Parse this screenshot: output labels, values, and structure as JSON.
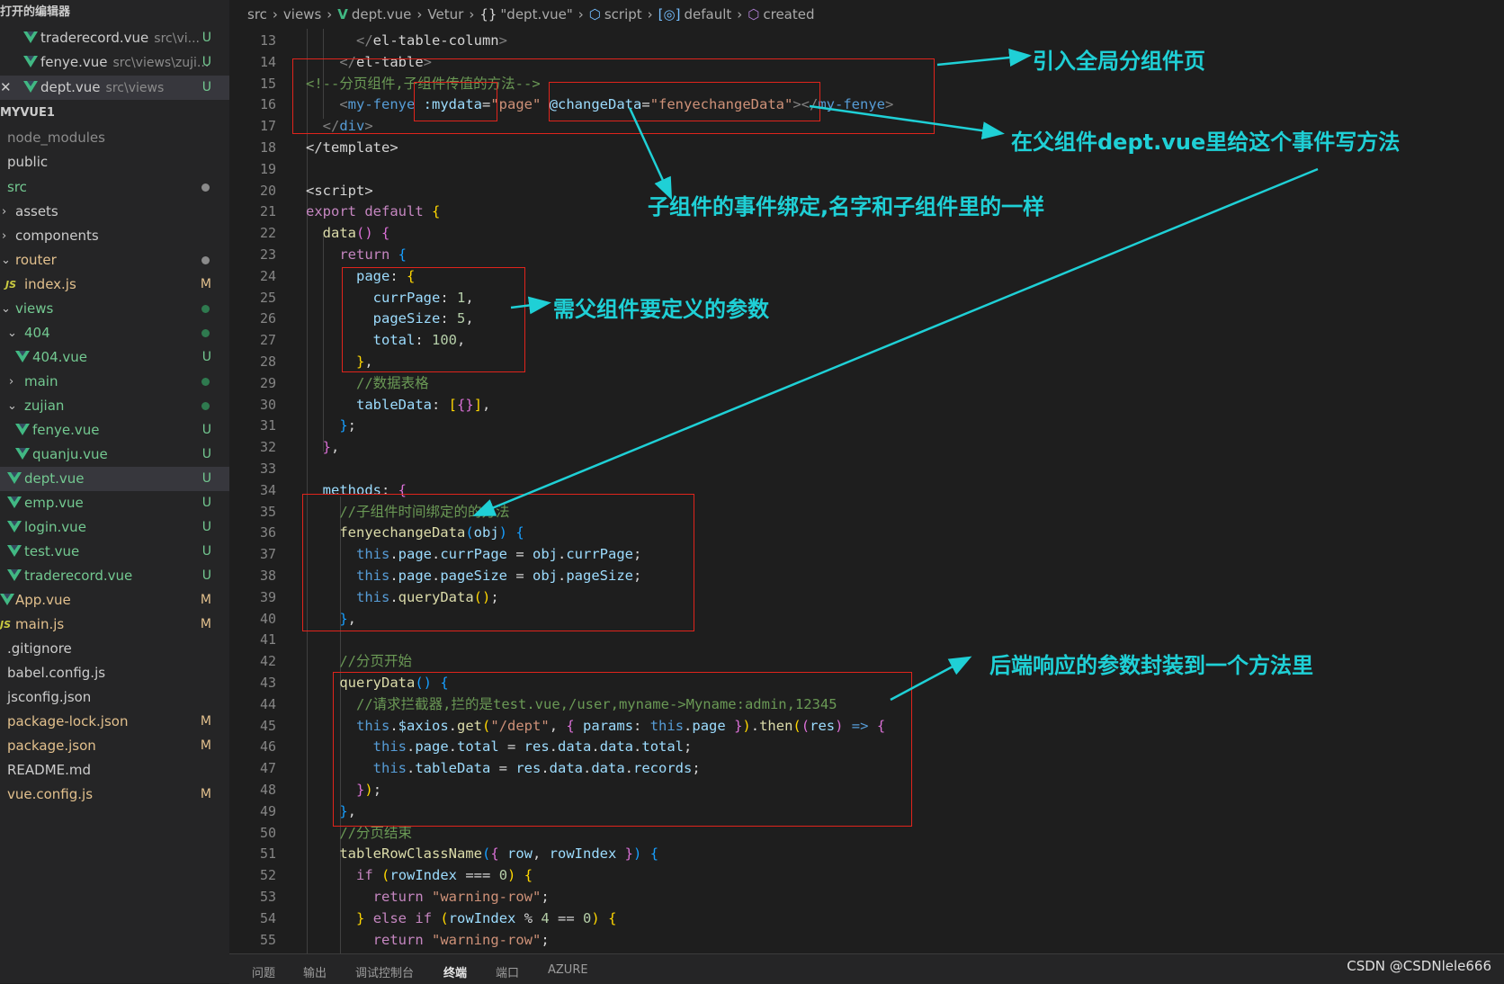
{
  "sidebar": {
    "open_editors_title": "打开的编辑器",
    "open_editors": [
      {
        "name": "traderecord.vue",
        "path": "src\\vi...",
        "badge": "U"
      },
      {
        "name": "fenye.vue",
        "path": "src\\views\\zuji...",
        "badge": "U"
      },
      {
        "name": "dept.vue",
        "path": "src\\views",
        "badge": "U"
      }
    ],
    "project_title": "MYVUE1",
    "tree": [
      {
        "name": "node_modules"
      },
      {
        "name": "public"
      },
      {
        "name": "src"
      },
      {
        "name": "assets"
      },
      {
        "name": "components"
      },
      {
        "name": "router"
      },
      {
        "name": "index.js",
        "badge": "M",
        "icon": "JS"
      },
      {
        "name": "views"
      },
      {
        "name": "404"
      },
      {
        "name": "404.vue",
        "badge": "U"
      },
      {
        "name": "main"
      },
      {
        "name": "zujian"
      },
      {
        "name": "fenye.vue",
        "badge": "U"
      },
      {
        "name": "quanju.vue",
        "badge": "U"
      },
      {
        "name": "dept.vue",
        "badge": "U"
      },
      {
        "name": "emp.vue",
        "badge": "U"
      },
      {
        "name": "login.vue",
        "badge": "U"
      },
      {
        "name": "test.vue",
        "badge": "U"
      },
      {
        "name": "traderecord.vue",
        "badge": "U"
      },
      {
        "name": "App.vue",
        "badge": "M"
      },
      {
        "name": "main.js",
        "badge": "M",
        "icon": "JS"
      },
      {
        "name": ".gitignore"
      },
      {
        "name": "babel.config.js"
      },
      {
        "name": "jsconfig.json"
      },
      {
        "name": "package-lock.json",
        "badge": "M"
      },
      {
        "name": "package.json",
        "badge": "M"
      },
      {
        "name": "README.md"
      },
      {
        "name": "vue.config.js",
        "badge": "M"
      }
    ]
  },
  "breadcrumb": [
    "src",
    "views",
    "dept.vue",
    "Vetur",
    "\"dept.vue\"",
    "script",
    "default",
    "created"
  ],
  "breadcrumb_icons": {
    "braces": "{}",
    "script": "⬡",
    "default": "[◎]",
    "created": "⬡"
  },
  "editor": {
    "line_numbers": [
      "13",
      "14",
      "15",
      "16",
      "17",
      "18",
      "19",
      "20",
      "21",
      "22",
      "23",
      "24",
      "25",
      "26",
      "27",
      "28",
      "29",
      "30",
      "31",
      "32",
      "33",
      "34",
      "35",
      "36",
      "37",
      "38",
      "39",
      "40",
      "41",
      "42",
      "43",
      "44",
      "45",
      "46",
      "47",
      "48",
      "49",
      "50",
      "51",
      "52",
      "53",
      "54",
      "55"
    ],
    "lines": [
      [
        [
          "t-tag",
          "      </"
        ],
        [
          "t-eltag",
          "el-table-column"
        ],
        [
          "t-tag",
          ">"
        ]
      ],
      [
        [
          "t-tag",
          "    </"
        ],
        [
          "t-eltag",
          "el-table"
        ],
        [
          "t-tag",
          ">"
        ]
      ],
      [
        [
          "t-com",
          "<!--分页组件,子组件传值的方法-->"
        ]
      ],
      [
        [
          "t-tag",
          "    <"
        ],
        [
          "t-tname",
          "my-fenye"
        ],
        [
          "t-plain",
          " "
        ],
        [
          "t-attr",
          ":mydata"
        ],
        [
          "t-plain",
          "="
        ],
        [
          "t-str",
          "\"page\""
        ],
        [
          "t-plain",
          " "
        ],
        [
          "t-attr",
          "@changeData"
        ],
        [
          "t-plain",
          "="
        ],
        [
          "t-str",
          "\"fenyechangeData\""
        ],
        [
          "t-tag",
          "></"
        ],
        [
          "t-tname",
          "my-fenye"
        ],
        [
          "t-tag",
          ">"
        ]
      ],
      [
        [
          "t-tag",
          "  </"
        ],
        [
          "t-tname",
          "div"
        ],
        [
          "t-tag",
          ">"
        ]
      ],
      [
        [
          "t-plain",
          "</template>"
        ]
      ],
      [
        [
          "t-plain",
          ""
        ]
      ],
      [
        [
          "t-plain",
          "<script>"
        ]
      ],
      [
        [
          "t-kw",
          "export"
        ],
        [
          "t-plain",
          " "
        ],
        [
          "t-kw",
          "default"
        ],
        [
          "t-plain",
          " "
        ],
        [
          "t-br1",
          "{"
        ]
      ],
      [
        [
          "t-plain",
          "  "
        ],
        [
          "t-fn",
          "data"
        ],
        [
          "t-br2",
          "()"
        ],
        [
          "t-plain",
          " "
        ],
        [
          "t-br2",
          "{"
        ]
      ],
      [
        [
          "t-plain",
          "    "
        ],
        [
          "t-kw",
          "return"
        ],
        [
          "t-plain",
          " "
        ],
        [
          "t-br3",
          "{"
        ]
      ],
      [
        [
          "t-plain",
          "      "
        ],
        [
          "t-var",
          "page"
        ],
        [
          "t-plain",
          ": "
        ],
        [
          "t-br1",
          "{"
        ]
      ],
      [
        [
          "t-plain",
          "        "
        ],
        [
          "t-var",
          "currPage"
        ],
        [
          "t-plain",
          ": "
        ],
        [
          "t-num",
          "1"
        ],
        [
          "t-plain",
          ","
        ]
      ],
      [
        [
          "t-plain",
          "        "
        ],
        [
          "t-var",
          "pageSize"
        ],
        [
          "t-plain",
          ": "
        ],
        [
          "t-num",
          "5"
        ],
        [
          "t-plain",
          ","
        ]
      ],
      [
        [
          "t-plain",
          "        "
        ],
        [
          "t-var",
          "total"
        ],
        [
          "t-plain",
          ": "
        ],
        [
          "t-num",
          "100"
        ],
        [
          "t-plain",
          ","
        ]
      ],
      [
        [
          "t-plain",
          "      "
        ],
        [
          "t-br1",
          "}"
        ],
        [
          "t-plain",
          ","
        ]
      ],
      [
        [
          "t-plain",
          "      "
        ],
        [
          "t-com",
          "//数据表格"
        ]
      ],
      [
        [
          "t-plain",
          "      "
        ],
        [
          "t-var",
          "tableData"
        ],
        [
          "t-plain",
          ": "
        ],
        [
          "t-br1",
          "["
        ],
        [
          "t-br2",
          "{}"
        ],
        [
          "t-br1",
          "]"
        ],
        [
          "t-plain",
          ","
        ]
      ],
      [
        [
          "t-plain",
          "    "
        ],
        [
          "t-br3",
          "}"
        ],
        [
          "t-plain",
          ";"
        ]
      ],
      [
        [
          "t-plain",
          "  "
        ],
        [
          "t-br2",
          "}"
        ],
        [
          "t-plain",
          ","
        ]
      ],
      [
        [
          "t-plain",
          ""
        ]
      ],
      [
        [
          "t-plain",
          "  "
        ],
        [
          "t-var",
          "methods"
        ],
        [
          "t-plain",
          ": "
        ],
        [
          "t-br2",
          "{"
        ]
      ],
      [
        [
          "t-plain",
          "    "
        ],
        [
          "t-com",
          "//子组件时间绑定的的方法"
        ]
      ],
      [
        [
          "t-plain",
          "    "
        ],
        [
          "t-fn",
          "fenyechangeData"
        ],
        [
          "t-br3",
          "("
        ],
        [
          "t-var",
          "obj"
        ],
        [
          "t-br3",
          ")"
        ],
        [
          "t-plain",
          " "
        ],
        [
          "t-br3",
          "{"
        ]
      ],
      [
        [
          "t-plain",
          "      "
        ],
        [
          "t-kw2",
          "this"
        ],
        [
          "t-plain",
          "."
        ],
        [
          "t-var",
          "page"
        ],
        [
          "t-plain",
          "."
        ],
        [
          "t-var",
          "currPage"
        ],
        [
          "t-plain",
          " = "
        ],
        [
          "t-var",
          "obj"
        ],
        [
          "t-plain",
          "."
        ],
        [
          "t-var",
          "currPage"
        ],
        [
          "t-plain",
          ";"
        ]
      ],
      [
        [
          "t-plain",
          "      "
        ],
        [
          "t-kw2",
          "this"
        ],
        [
          "t-plain",
          "."
        ],
        [
          "t-var",
          "page"
        ],
        [
          "t-plain",
          "."
        ],
        [
          "t-var",
          "pageSize"
        ],
        [
          "t-plain",
          " = "
        ],
        [
          "t-var",
          "obj"
        ],
        [
          "t-plain",
          "."
        ],
        [
          "t-var",
          "pageSize"
        ],
        [
          "t-plain",
          ";"
        ]
      ],
      [
        [
          "t-plain",
          "      "
        ],
        [
          "t-kw2",
          "this"
        ],
        [
          "t-plain",
          "."
        ],
        [
          "t-fn",
          "queryData"
        ],
        [
          "t-br1",
          "()"
        ],
        [
          "t-plain",
          ";"
        ]
      ],
      [
        [
          "t-plain",
          "    "
        ],
        [
          "t-br3",
          "}"
        ],
        [
          "t-plain",
          ","
        ]
      ],
      [
        [
          "t-plain",
          ""
        ]
      ],
      [
        [
          "t-plain",
          "    "
        ],
        [
          "t-com",
          "//分页开始"
        ]
      ],
      [
        [
          "t-plain",
          "    "
        ],
        [
          "t-fn",
          "queryData"
        ],
        [
          "t-br3",
          "()"
        ],
        [
          "t-plain",
          " "
        ],
        [
          "t-br3",
          "{"
        ]
      ],
      [
        [
          "t-plain",
          "      "
        ],
        [
          "t-com",
          "//请求拦截器,拦的是test.vue,/user,myname->Myname:admin,12345"
        ]
      ],
      [
        [
          "t-plain",
          "      "
        ],
        [
          "t-kw2",
          "this"
        ],
        [
          "t-plain",
          "."
        ],
        [
          "t-var",
          "$axios"
        ],
        [
          "t-plain",
          "."
        ],
        [
          "t-fn",
          "get"
        ],
        [
          "t-br1",
          "("
        ],
        [
          "t-str",
          "\"/dept\""
        ],
        [
          "t-plain",
          ", "
        ],
        [
          "t-br2",
          "{"
        ],
        [
          "t-plain",
          " "
        ],
        [
          "t-var",
          "params"
        ],
        [
          "t-plain",
          ": "
        ],
        [
          "t-kw2",
          "this"
        ],
        [
          "t-plain",
          "."
        ],
        [
          "t-var",
          "page"
        ],
        [
          "t-plain",
          " "
        ],
        [
          "t-br2",
          "}"
        ],
        [
          "t-br1",
          ")"
        ],
        [
          "t-plain",
          "."
        ],
        [
          "t-fn",
          "then"
        ],
        [
          "t-br1",
          "("
        ],
        [
          "t-br2",
          "("
        ],
        [
          "t-var",
          "res"
        ],
        [
          "t-br2",
          ")"
        ],
        [
          "t-plain",
          " "
        ],
        [
          "t-kw2",
          "=>"
        ],
        [
          "t-plain",
          " "
        ],
        [
          "t-br2",
          "{"
        ]
      ],
      [
        [
          "t-plain",
          "        "
        ],
        [
          "t-kw2",
          "this"
        ],
        [
          "t-plain",
          "."
        ],
        [
          "t-var",
          "page"
        ],
        [
          "t-plain",
          "."
        ],
        [
          "t-var",
          "total"
        ],
        [
          "t-plain",
          " = "
        ],
        [
          "t-var",
          "res"
        ],
        [
          "t-plain",
          "."
        ],
        [
          "t-var",
          "data"
        ],
        [
          "t-plain",
          "."
        ],
        [
          "t-var",
          "data"
        ],
        [
          "t-plain",
          "."
        ],
        [
          "t-var",
          "total"
        ],
        [
          "t-plain",
          ";"
        ]
      ],
      [
        [
          "t-plain",
          "        "
        ],
        [
          "t-kw2",
          "this"
        ],
        [
          "t-plain",
          "."
        ],
        [
          "t-var",
          "tableData"
        ],
        [
          "t-plain",
          " = "
        ],
        [
          "t-var",
          "res"
        ],
        [
          "t-plain",
          "."
        ],
        [
          "t-var",
          "data"
        ],
        [
          "t-plain",
          "."
        ],
        [
          "t-var",
          "data"
        ],
        [
          "t-plain",
          "."
        ],
        [
          "t-var",
          "records"
        ],
        [
          "t-plain",
          ";"
        ]
      ],
      [
        [
          "t-plain",
          "      "
        ],
        [
          "t-br2",
          "}"
        ],
        [
          "t-br1",
          ")"
        ],
        [
          "t-plain",
          ";"
        ]
      ],
      [
        [
          "t-plain",
          "    "
        ],
        [
          "t-br3",
          "}"
        ],
        [
          "t-plain",
          ","
        ]
      ],
      [
        [
          "t-plain",
          "    "
        ],
        [
          "t-com",
          "//分页结束"
        ]
      ],
      [
        [
          "t-plain",
          "    "
        ],
        [
          "t-fn",
          "tableRowClassName"
        ],
        [
          "t-br3",
          "("
        ],
        [
          "t-br2",
          "{"
        ],
        [
          "t-plain",
          " "
        ],
        [
          "t-var",
          "row"
        ],
        [
          "t-plain",
          ", "
        ],
        [
          "t-var",
          "rowIndex"
        ],
        [
          "t-plain",
          " "
        ],
        [
          "t-br2",
          "}"
        ],
        [
          "t-br3",
          ")"
        ],
        [
          "t-plain",
          " "
        ],
        [
          "t-br3",
          "{"
        ]
      ],
      [
        [
          "t-plain",
          "      "
        ],
        [
          "t-kw",
          "if"
        ],
        [
          "t-plain",
          " "
        ],
        [
          "t-br1",
          "("
        ],
        [
          "t-var",
          "rowIndex"
        ],
        [
          "t-plain",
          " === "
        ],
        [
          "t-num",
          "0"
        ],
        [
          "t-br1",
          ")"
        ],
        [
          "t-plain",
          " "
        ],
        [
          "t-br1",
          "{"
        ]
      ],
      [
        [
          "t-plain",
          "        "
        ],
        [
          "t-kw",
          "return"
        ],
        [
          "t-plain",
          " "
        ],
        [
          "t-str",
          "\"warning-row\""
        ],
        [
          "t-plain",
          ";"
        ]
      ],
      [
        [
          "t-plain",
          "      "
        ],
        [
          "t-br1",
          "}"
        ],
        [
          "t-plain",
          " "
        ],
        [
          "t-kw",
          "else"
        ],
        [
          "t-plain",
          " "
        ],
        [
          "t-kw",
          "if"
        ],
        [
          "t-plain",
          " "
        ],
        [
          "t-br1",
          "("
        ],
        [
          "t-var",
          "rowIndex"
        ],
        [
          "t-plain",
          " % "
        ],
        [
          "t-num",
          "4"
        ],
        [
          "t-plain",
          " == "
        ],
        [
          "t-num",
          "0"
        ],
        [
          "t-br1",
          ")"
        ],
        [
          "t-plain",
          " "
        ],
        [
          "t-br1",
          "{"
        ]
      ],
      [
        [
          "t-plain",
          "        "
        ],
        [
          "t-kw",
          "return"
        ],
        [
          "t-plain",
          " "
        ],
        [
          "t-str",
          "\"warning-row\""
        ],
        [
          "t-plain",
          ";"
        ]
      ]
    ]
  },
  "annotations": [
    "引入全局分组件页",
    "在父组件dept.vue里给这个事件写方法",
    "子组件的事件绑定,名字和子组件里的一样",
    "需父组件要定义的参数",
    "后端响应的参数封装到一个方法里"
  ],
  "colors": {
    "annotation": "#1fd0d6",
    "box": "#e0241c",
    "vue": "#41b883"
  },
  "panel_tabs": [
    "问题",
    "输出",
    "调试控制台",
    "终端",
    "端口",
    "AZURE"
  ],
  "watermark": "CSDN @CSDNlele666"
}
